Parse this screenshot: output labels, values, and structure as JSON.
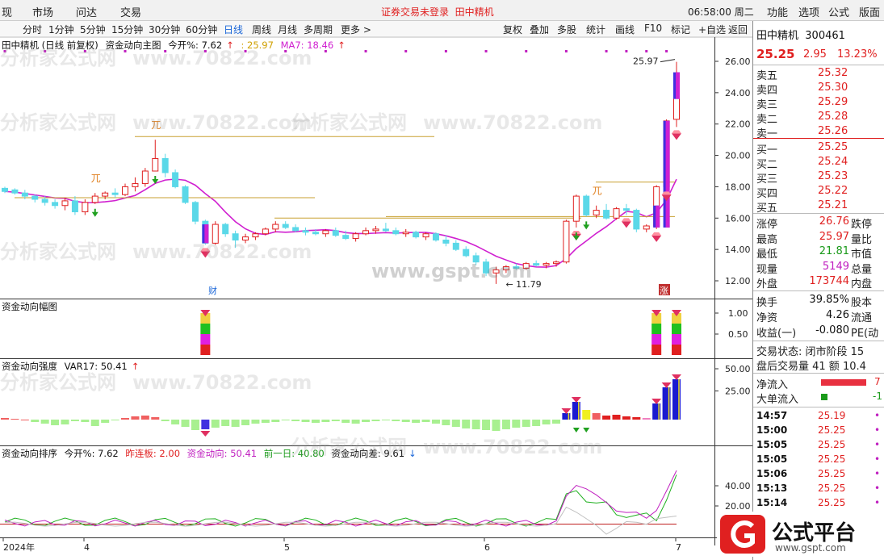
{
  "menubar": {
    "left_items": [
      "现",
      "市场",
      "问达",
      "交易"
    ],
    "notice": "证券交易未登录",
    "stock_name_red": "田中精机",
    "clock": "06:58:00 周二",
    "right_items": [
      "功能",
      "选项",
      "公式",
      "版面"
    ]
  },
  "tabs": {
    "periods": [
      "分时",
      "1分钟",
      "5分钟",
      "15分钟",
      "30分钟",
      "60分钟",
      "日线",
      "周线",
      "月线",
      "多周期",
      "更多 >"
    ],
    "active": "日线",
    "tools": [
      "复权",
      "叠加",
      "多股",
      "统计",
      "画线",
      "F10",
      "标记",
      "+自选",
      "返回"
    ]
  },
  "main_panel": {
    "title": "田中精机 (日线 前复权)",
    "indicator": "资金动向主图",
    "kaikai_label": "今开%: 7.62",
    "value2": ": 25.97",
    "ma_label": "MA7: 18.46",
    "high_label": "25.97",
    "low_label": "11.79",
    "cai_badge": "财",
    "zhang_badge": "涨",
    "yticks": [
      "26.00",
      "24.00",
      "22.00",
      "20.00",
      "18.00",
      "16.00",
      "14.00",
      "12.00"
    ]
  },
  "panel2": {
    "title": "资金动向幅图",
    "yticks": [
      "1.00",
      "0.50"
    ]
  },
  "panel3": {
    "title": "资金动向强度",
    "var_label": "VAR17: 50.41",
    "yticks": [
      "50.00",
      "25.00"
    ]
  },
  "panel4": {
    "title": "资金动向排序",
    "kaikai_label": "今开%: 7.62",
    "zuolianban": "昨连板: 2.00",
    "zijin": "资金动向: 50.41",
    "qianyiri": "前一日: 40.80",
    "cha": "资金动向差: 9.61",
    "yticks": [
      "40.00",
      "20.00"
    ]
  },
  "xaxis": {
    "labels": [
      "2024年",
      "4",
      "5",
      "6",
      "7"
    ]
  },
  "quote": {
    "name": "田中精机",
    "code": "300461",
    "price": "25.25",
    "change": "2.95",
    "change_pct": "13.23%",
    "asks": [
      {
        "label": "卖五",
        "price": "25.32"
      },
      {
        "label": "卖四",
        "price": "25.30"
      },
      {
        "label": "卖三",
        "price": "25.29"
      },
      {
        "label": "卖二",
        "price": "25.28"
      },
      {
        "label": "卖一",
        "price": "25.26"
      }
    ],
    "bids": [
      {
        "label": "买一",
        "price": "25.25"
      },
      {
        "label": "买二",
        "price": "25.24"
      },
      {
        "label": "买三",
        "price": "25.23"
      },
      {
        "label": "买四",
        "price": "25.22"
      },
      {
        "label": "买五",
        "price": "25.21"
      }
    ],
    "stats": [
      {
        "label": "涨停",
        "value": "26.76",
        "label2": "跌停",
        "color": "#e02020"
      },
      {
        "label": "最高",
        "value": "25.97",
        "label2": "量比",
        "color": "#e02020"
      },
      {
        "label": "最低",
        "value": "21.81",
        "label2": "市值",
        "color": "#1a9a1a"
      },
      {
        "label": "现量",
        "value": "5149",
        "label2": "总量",
        "color": "#c020c0"
      },
      {
        "label": "外盘",
        "value": "173744",
        "label2": "内盘",
        "color": "#e02020"
      }
    ],
    "stats2": [
      {
        "label": "换手",
        "value": "39.85%",
        "label2": "股本"
      },
      {
        "label": "净资",
        "value": "4.26",
        "label2": "流通"
      },
      {
        "label": "收益(一)",
        "value": "-0.080",
        "label2": "PE(动"
      }
    ],
    "status": "交易状态: 闭市阶段 15",
    "after_hours": "盘后交易量 41 额 10.4",
    "net_inflow": "净流入",
    "big_inflow": "大单流入",
    "net_inflow_val": "7",
    "big_inflow_val": "-1",
    "ticks": [
      {
        "time": "14:57",
        "price": "25.19"
      },
      {
        "time": "15:00",
        "price": "25.25"
      },
      {
        "time": "15:05",
        "price": "25.25"
      },
      {
        "time": "15:05",
        "price": "25.25"
      },
      {
        "time": "15:06",
        "price": "25.25"
      },
      {
        "time": "15:13",
        "price": "25.25"
      },
      {
        "time": "15:14",
        "price": "25.25"
      }
    ]
  },
  "logo": {
    "text": "公式平台",
    "url_text": "www.gspt.com"
  },
  "watermarks": [
    "www.70822.com",
    "分析家公式网",
    "www.gspt.com"
  ],
  "colors": {
    "up": "#e02020",
    "down": "#5ad8e8",
    "ma": "#d020d0",
    "green": "#20a020"
  }
}
